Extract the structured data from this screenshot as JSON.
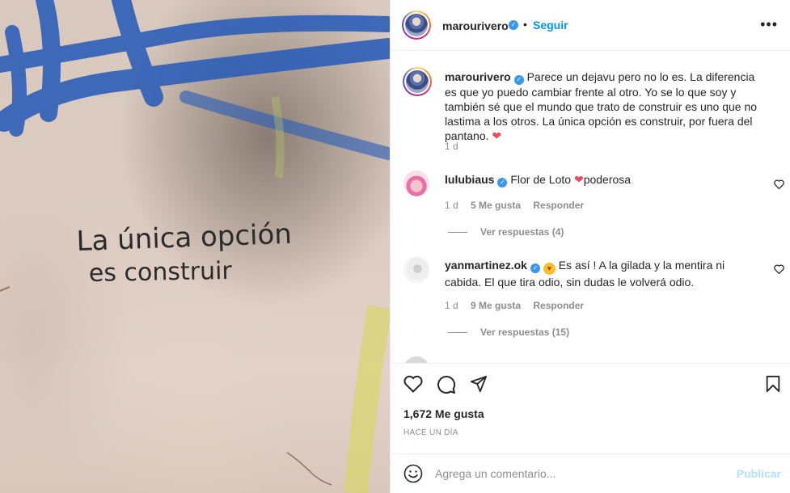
{
  "photo": {
    "wall_text_line1": "La única opción",
    "wall_text_line2": "es construir"
  },
  "header": {
    "username": "marourivero",
    "separator": "•",
    "follow_label": "Seguir",
    "more_icon": "more-horizontal-icon"
  },
  "caption": {
    "username": "marourivero",
    "text": "Parece un dejavu pero no lo es. La diferencia es que yo puedo cambiar frente al otro. Yo se lo que soy y también sé que el mundo que trato de construir es uno que no lastima a los otros. La única opción es construir, por fuera del pantano.",
    "emoji": "❤",
    "time": "1 d"
  },
  "comments": [
    {
      "username": "lulubiaus",
      "text_before": "Flor de Loto",
      "emoji": "❤",
      "text_after": "poderosa",
      "time": "1 d",
      "likes": "5 Me gusta",
      "reply_label": "Responder",
      "view_replies": "Ver respuestas (4)"
    },
    {
      "username": "yanmartinez.ok",
      "emoji": "😍",
      "text": "Es así ! A la gilada y la mentira ni cabida. El que tira odio, sin dudas le volverá odio.",
      "time": "1 d",
      "likes": "9 Me gusta",
      "reply_label": "Responder",
      "view_replies": "Ver respuestas (15)"
    }
  ],
  "actions": {
    "like_icon": "heart-icon",
    "comment_icon": "comment-icon",
    "share_icon": "share-icon",
    "save_icon": "bookmark-icon"
  },
  "likes_text": "1,672 Me gusta",
  "time_ago": "HACE UN DÍA",
  "add_comment": {
    "placeholder": "Agrega un comentario...",
    "publish_label": "Publicar",
    "emoji_icon": "smile-icon"
  },
  "colors": {
    "link_blue": "#0095f6",
    "verified_blue": "#3897f0",
    "heart_red": "#ed4956",
    "publish_disabled": "#b2dffc",
    "muted": "#8e8e8e"
  }
}
